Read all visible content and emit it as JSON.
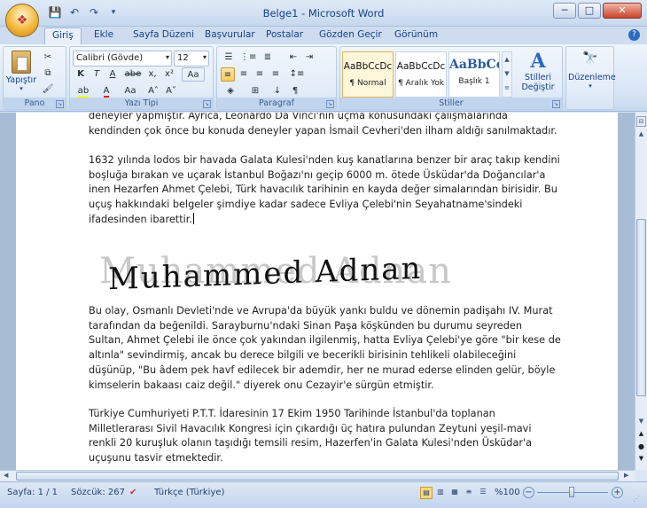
{
  "window": {
    "title": "Belge1 - Microsoft Word",
    "controls": {
      "minimize": "─",
      "maximize": "□",
      "close": "✕"
    }
  },
  "qat": [
    "save-icon",
    "undo-icon",
    "redo-icon"
  ],
  "tabs": [
    "Giriş",
    "Ekle",
    "Sayfa Düzeni",
    "Başvurular",
    "Postalar",
    "Gözden Geçir",
    "Görünüm"
  ],
  "ribbon": {
    "clipboard": {
      "label": "Pano",
      "paste": "Yapıştır"
    },
    "font": {
      "label": "Yazı Tipi",
      "family": "Calibri (Gövde)",
      "size": "12"
    },
    "paragraph": {
      "label": "Paragraf"
    },
    "styles": {
      "label": "Stiller",
      "items": [
        {
          "sample": "AaBbCcDc",
          "name": "¶ Normal"
        },
        {
          "sample": "AaBbCcDc",
          "name": "¶ Aralık Yok"
        },
        {
          "sample": "AaBbCc",
          "name": "Başlık 1"
        }
      ],
      "change_styles": "Stilleri Değiştir"
    },
    "editing": {
      "label": "Düzenleme"
    }
  },
  "document": {
    "para1": [
      "deneyler yapmıştır. Ayrıca, Leonardo Da Vinci'nin uçma konusundaki çalışmalarında",
      "kendinden çok önce bu konuda deneyler yapan İsmail Cevheri'den ilham aldığı sanılmaktadır."
    ],
    "para2": [
      "1632 yılında lodos bir havada Galata Kulesi'nden kuş kanatlarına benzer bir araç takıp kendini",
      "boşluğa bırakan ve uçarak İstanbul Boğazı'nı geçip 6000 m. ötede Üsküdar'da Doğancılar'a",
      "inen Hezarfen Ahmet Çelebi, Türk havacılık tarihinin en kayda değer simalarından birisidir. Bu",
      "uçuş hakkındaki belgeler şimdiye kadar sadece Evliya Çelebi'nin Seyahatname'sindeki",
      "ifadesinden ibarettir."
    ],
    "wordart": "Muhammed Adnan",
    "para3": [
      "Bu olay, Osmanlı Devleti'nde ve Avrupa'da büyük yankı buldu ve dönemin padişahı IV. Murat",
      "tarafından da beğenildi. Sarayburnu'ndaki Sinan Paşa köşkünden bu durumu seyreden",
      "Sultan, Ahmet Çelebi ile önce çok yakından ilgilenmiş, hatta Evliya Çelebi'ye göre \"bir kese de",
      "altınla\" sevindirmiş, ancak bu derece bilgili ve becerikli birisinin tehlikeli olabileceğini",
      "düşünüp, \"Bu âdem pek havf edilecek bir ademdir, her ne murad ederse elinden gelür, böyle",
      "kimselerin bakaası caiz değil.\" diyerek onu Cezayir'e sürgün etmiştir."
    ],
    "para4": [
      "Türkiye Cumhuriyeti P.T.T. İdaresinin 17 Ekim 1950 Tarihinde İstanbul'da toplanan",
      "Milletlerarası Sivil Havacılık Kongresi için çıkardığı üç hatıra pulundan Zeytuni yeşil-mavi",
      "renkli 20 kuruşluk olanın taşıdığı temsili resim, Hazerfen'in Galata Kulesi'nden Üsküdar'a",
      "uçuşunu tasvir etmektedir."
    ]
  },
  "status": {
    "page": "Sayfa: 1 / 1",
    "words": "Sözcük: 267",
    "language": "Türkçe (Türkiye)",
    "zoom": "%100"
  },
  "colors": {
    "accent": "#15428b",
    "ribbon": "#d9e6f6"
  }
}
